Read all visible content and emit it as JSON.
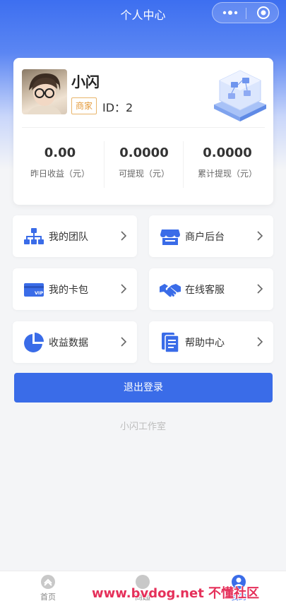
{
  "nav": {
    "title": "个人中心"
  },
  "profile": {
    "name": "小闪",
    "badge": "商家",
    "id_label": "ID：2",
    "stats": [
      {
        "value": "0.00",
        "label": "昨日收益（元）"
      },
      {
        "value": "0.0000",
        "label": "可提现（元）"
      },
      {
        "value": "0.0000",
        "label": "累计提现（元）"
      }
    ]
  },
  "menu": [
    {
      "label": "我的团队",
      "icon": "team-org-icon"
    },
    {
      "label": "商户后台",
      "icon": "shop-icon"
    },
    {
      "label": "我的卡包",
      "icon": "vip-card-icon"
    },
    {
      "label": "在线客服",
      "icon": "handshake-icon"
    },
    {
      "label": "收益数据",
      "icon": "pie-chart-icon"
    },
    {
      "label": "帮助中心",
      "icon": "document-icon"
    }
  ],
  "logout_label": "退出登录",
  "studio_label": "小闪工作室",
  "tabs": [
    {
      "label": "首页"
    },
    {
      "label": "商超"
    },
    {
      "label": "我的"
    }
  ],
  "watermark": "www.bvdog.net 不懂社区",
  "colors": {
    "primary": "#3a6ce8",
    "badge": "#e49a3b",
    "watermark": "#e5305a"
  }
}
